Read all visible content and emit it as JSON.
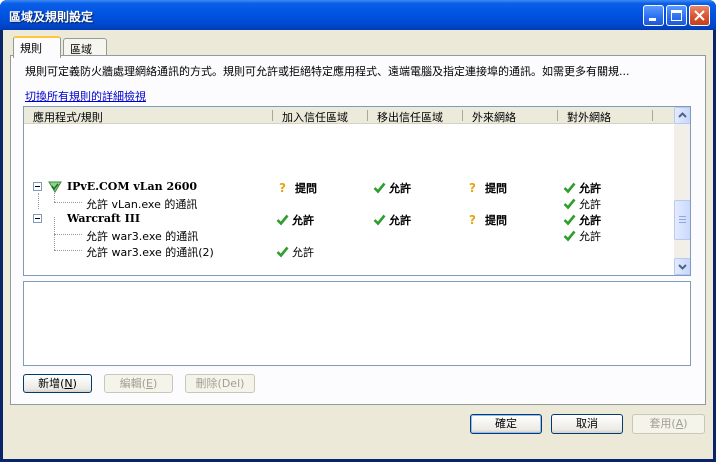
{
  "window": {
    "title": "區域及規則設定"
  },
  "tabs": [
    {
      "label": "規則",
      "active": true
    },
    {
      "label": "區域",
      "active": false
    }
  ],
  "description": "規則可定義防火牆處理網絡通訊的方式。規則可允許或拒絕特定應用程式、遠端電腦及指定連接埠的通訊。如需更多有關規...",
  "detail_link": "切換所有規則的詳細檢視",
  "columns": [
    "應用程式/規則",
    "加入信任區域",
    "移出信任區域",
    "外來網絡",
    "對外網絡"
  ],
  "rows": [
    {
      "name": "IPvE.COM vLan 2600",
      "level": 0,
      "bold": true,
      "cells": [
        {
          "icon": "question-icon",
          "text": "提問",
          "bold": true
        },
        {
          "icon": "check-icon",
          "text": "允許",
          "bold": true
        },
        {
          "icon": "question-icon",
          "text": "提問",
          "bold": true
        },
        {
          "icon": "check-icon",
          "text": "允許",
          "bold": true
        }
      ]
    },
    {
      "name": "允許 vLan.exe 的通訊",
      "level": 1,
      "bold": false,
      "cells": [
        null,
        null,
        null,
        {
          "icon": "check-icon",
          "text": "允許",
          "bold": false
        }
      ]
    },
    {
      "name": "Warcraft III",
      "level": 0,
      "bold": true,
      "cells": [
        {
          "icon": "check-icon",
          "text": "允許",
          "bold": true
        },
        {
          "icon": "check-icon",
          "text": "允許",
          "bold": true
        },
        {
          "icon": "question-icon",
          "text": "提問",
          "bold": true
        },
        {
          "icon": "check-icon",
          "text": "允許",
          "bold": true
        }
      ]
    },
    {
      "name": "允許 war3.exe 的通訊",
      "level": 1,
      "bold": false,
      "cells": [
        null,
        null,
        null,
        {
          "icon": "check-icon",
          "text": "允許",
          "bold": false
        }
      ]
    },
    {
      "name": "允許 war3.exe 的通訊(2)",
      "level": 1,
      "bold": false,
      "cells": [
        {
          "icon": "check-icon",
          "text": "允許",
          "bold": false
        },
        null,
        null,
        null
      ]
    }
  ],
  "buttons": {
    "add": {
      "label": "新增(",
      "key": "N",
      "suffix": ")"
    },
    "edit": {
      "label": "編輯(",
      "key": "E",
      "suffix": ")"
    },
    "delete": {
      "label": "刪除(Del)"
    },
    "ok": {
      "label": "確定"
    },
    "cancel": {
      "label": "取消"
    },
    "apply": {
      "label": "套用(",
      "key": "A",
      "suffix": ")"
    }
  },
  "colors": {
    "check": "#2f9e2f",
    "question": "#e8a316",
    "titlebar": "#0054e3"
  }
}
